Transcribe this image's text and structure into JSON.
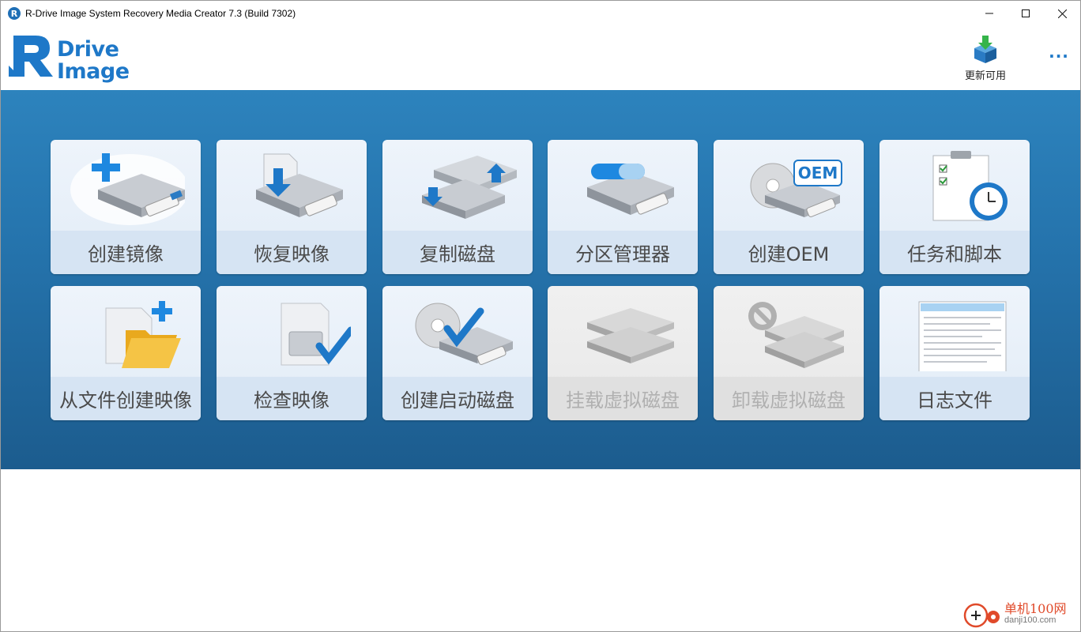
{
  "window": {
    "title": "R-Drive Image System Recovery Media Creator 7.3 (Build 7302)",
    "app_icon_letter": "R"
  },
  "header": {
    "logo_line1": "Drive",
    "logo_line2": "Image",
    "update_label": "更新可用",
    "more_label": "···"
  },
  "tiles": [
    {
      "label": "创建镜像",
      "icon": "create-image-icon",
      "enabled": true
    },
    {
      "label": "恢复映像",
      "icon": "restore-image-icon",
      "enabled": true
    },
    {
      "label": "复制磁盘",
      "icon": "copy-disk-icon",
      "enabled": true
    },
    {
      "label": "分区管理器",
      "icon": "partition-manager-icon",
      "enabled": true
    },
    {
      "label": "创建OEM",
      "icon": "create-oem-icon",
      "enabled": true
    },
    {
      "label": "任务和脚本",
      "icon": "tasks-scripts-icon",
      "enabled": true
    },
    {
      "label": "从文件创建映像",
      "icon": "create-image-from-files-icon",
      "enabled": true
    },
    {
      "label": "检查映像",
      "icon": "check-image-icon",
      "enabled": true
    },
    {
      "label": "创建启动磁盘",
      "icon": "create-boot-disk-icon",
      "enabled": true
    },
    {
      "label": "挂载虚拟磁盘",
      "icon": "mount-virtual-disk-icon",
      "enabled": false
    },
    {
      "label": "卸载虚拟磁盘",
      "icon": "unmount-virtual-disk-icon",
      "enabled": false
    },
    {
      "label": "日志文件",
      "icon": "log-file-icon",
      "enabled": true
    }
  ],
  "watermark": {
    "main": "单机100网",
    "sub": "danji100.com"
  },
  "colors": {
    "brand_blue": "#1e78c8",
    "panel_top": "#2d83bd",
    "panel_bottom": "#1c5c8e",
    "tile_bg": "#e2ecf7",
    "disabled_label": "#b0b0b0"
  }
}
